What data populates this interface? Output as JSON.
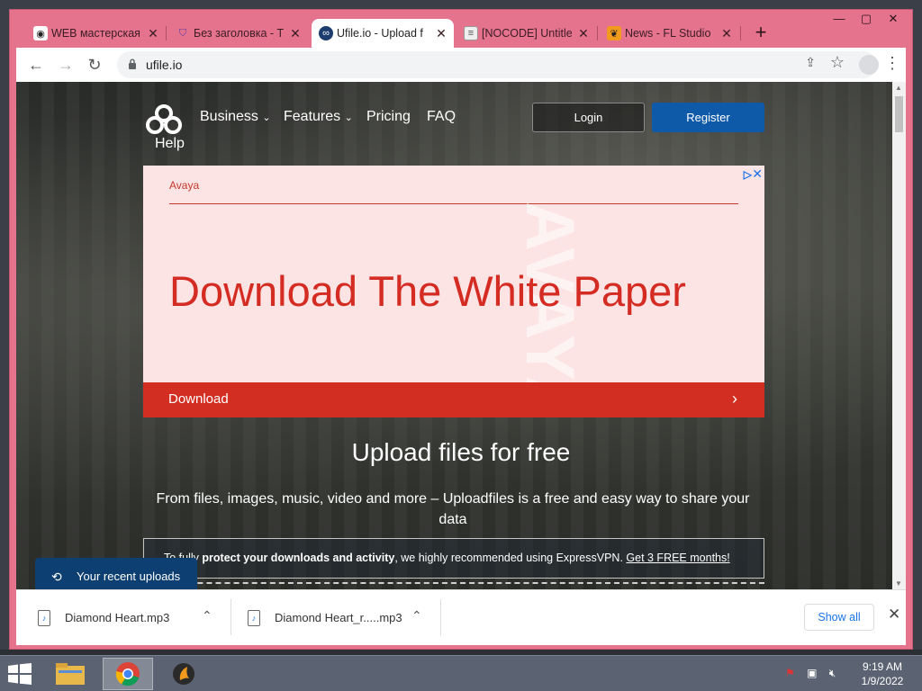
{
  "browser": {
    "tabs": [
      {
        "title": "WEB мастерская",
        "icon": "eye-icon"
      },
      {
        "title": "Без заголовка - Т",
        "icon": "shield-icon"
      },
      {
        "title": "Ufile.io - Upload f",
        "icon": "ufile-icon"
      },
      {
        "title": "[NOCODE] Untitle",
        "icon": "doc-icon"
      },
      {
        "title": "News - FL Studio",
        "icon": "fl-studio-icon"
      }
    ],
    "url": "ufile.io"
  },
  "site": {
    "nav": {
      "business": "Business",
      "features": "Features",
      "pricing": "Pricing",
      "faq": "FAQ",
      "help": "Help",
      "login": "Login",
      "register": "Register"
    },
    "ad": {
      "brand": "Avaya",
      "watermark": "AVAYA",
      "headline": "Download The White Paper",
      "cta": "Download"
    },
    "hero": {
      "title": "Upload files for free",
      "subtitle": "From files, images, music, video and more – Uploadfiles is a free and easy way to share your data"
    },
    "vpn": {
      "lead": "To fully ",
      "bold": "protect your downloads and activity",
      "rest": ", we highly recommended using ExpressVPN. ",
      "link": "Get 3 FREE months!"
    },
    "recent_uploads": "Your recent uploads"
  },
  "downloads": {
    "items": [
      {
        "name": "Diamond Heart.mp3"
      },
      {
        "name": "Diamond Heart_r.....mp3"
      }
    ],
    "show_all": "Show all"
  },
  "taskbar": {
    "time": "9:19 AM",
    "date": "1/9/2022"
  },
  "colors": {
    "window_frame": "#e6738e",
    "register": "#0e5aa8",
    "ad_red": "#d32e22",
    "recent_uploads": "#0e3f73"
  }
}
